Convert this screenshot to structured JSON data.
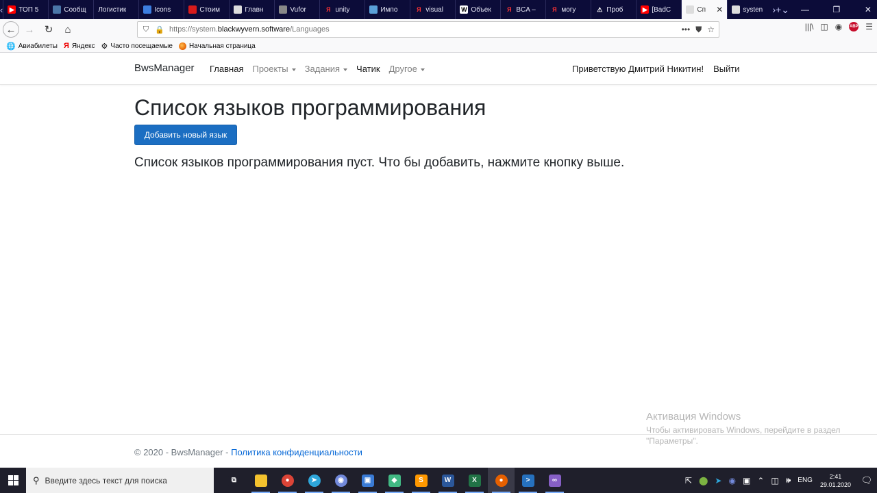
{
  "browser": {
    "tabs": [
      {
        "label": "ТОП 5",
        "icon": "youtube-icon",
        "color": "#ff0000"
      },
      {
        "label": "Сообщ",
        "icon": "chat-icon",
        "color": "#4a76a8"
      },
      {
        "label": "Логистик",
        "icon": "",
        "color": ""
      },
      {
        "label": "Icons",
        "icon": "flag-icon",
        "color": "#3d7ee0"
      },
      {
        "label": "Стоим",
        "icon": "tag-icon",
        "color": "#d81b1b"
      },
      {
        "label": "Главн",
        "icon": "page-icon",
        "color": "#dddddd"
      },
      {
        "label": "Vufor",
        "icon": "vuforia-icon",
        "color": "#888888"
      },
      {
        "label": "unity",
        "icon": "yandex-icon",
        "color": "#ff0000"
      },
      {
        "label": "Импо",
        "icon": "gear-icon",
        "color": "#5aa0d8"
      },
      {
        "label": "visual",
        "icon": "yandex-icon",
        "color": "#ff0000"
      },
      {
        "label": "Объек",
        "icon": "wikipedia-icon",
        "color": "#ffffff"
      },
      {
        "label": "BCA –",
        "icon": "yandex-icon",
        "color": "#ff0000"
      },
      {
        "label": "могу",
        "icon": "yandex-icon",
        "color": "#ff0000"
      },
      {
        "label": "Проб",
        "icon": "warning-icon",
        "color": "#ffffff"
      },
      {
        "label": "[BadC",
        "icon": "youtube-icon",
        "color": "#ff0000"
      },
      {
        "label": "Сп",
        "icon": "page-icon",
        "color": "#dddddd",
        "active": true
      },
      {
        "label": "systen",
        "icon": "page-icon",
        "color": "#dddddd"
      }
    ],
    "url_prefix": "https://system.",
    "url_domain": "blackwyvern.software",
    "url_path": "/Languages"
  },
  "bookmarks": [
    {
      "label": "Авиабилеты",
      "icon": "globe-icon"
    },
    {
      "label": "Яндекс",
      "icon": "yandex-icon"
    },
    {
      "label": "Часто посещаемые",
      "icon": "gear-icon"
    },
    {
      "label": "Начальная страница",
      "icon": "firefox-icon"
    }
  ],
  "site": {
    "brand": "BwsManager",
    "nav": {
      "home": "Главная",
      "projects": "Проекты",
      "tasks": "Задания",
      "chat": "Чатик",
      "other": "Другое"
    },
    "greeting": "Приветствую Дмитрий Никитин!",
    "logout": "Выйти"
  },
  "main": {
    "title": "Список языков программирования",
    "add_button": "Добавить новый язык",
    "empty_message": "Список языков программирования пуст. Что бы добавить, нажмите кнопку выше."
  },
  "footer": {
    "copyright": "© 2020 - BwsManager - ",
    "privacy_link": "Политика конфиденциальности"
  },
  "watermark": {
    "title": "Активация Windows",
    "text": "Чтобы активировать Windows, перейдите в раздел \"Параметры\"."
  },
  "taskbar": {
    "search_placeholder": "Введите здесь текст для поиска",
    "language": "ENG",
    "time": "2:41",
    "date": "29.01.2020",
    "apps": [
      {
        "name": "task-view-icon",
        "color": "#1f1f2b",
        "glyph": "⧉"
      },
      {
        "name": "file-explorer-icon",
        "color": "#f4c22e",
        "glyph": ""
      },
      {
        "name": "chrome-icon",
        "color": "#db4437",
        "glyph": "●"
      },
      {
        "name": "telegram-icon",
        "color": "#2ea6da",
        "glyph": "➤"
      },
      {
        "name": "discord-icon",
        "color": "#7289da",
        "glyph": "◉"
      },
      {
        "name": "network-app-icon",
        "color": "#3a7bd5",
        "glyph": "▣"
      },
      {
        "name": "git-icon",
        "color": "#41b883",
        "glyph": "◆"
      },
      {
        "name": "sublime-icon",
        "color": "#ff9800",
        "glyph": "S"
      },
      {
        "name": "word-icon",
        "color": "#2b579a",
        "glyph": "W"
      },
      {
        "name": "excel-icon",
        "color": "#217346",
        "glyph": "X"
      },
      {
        "name": "firefox-icon",
        "color": "#e66000",
        "glyph": "●"
      },
      {
        "name": "powershell-icon",
        "color": "#2671be",
        "glyph": ">"
      },
      {
        "name": "visual-studio-icon",
        "color": "#865fc5",
        "glyph": "∞"
      }
    ]
  }
}
